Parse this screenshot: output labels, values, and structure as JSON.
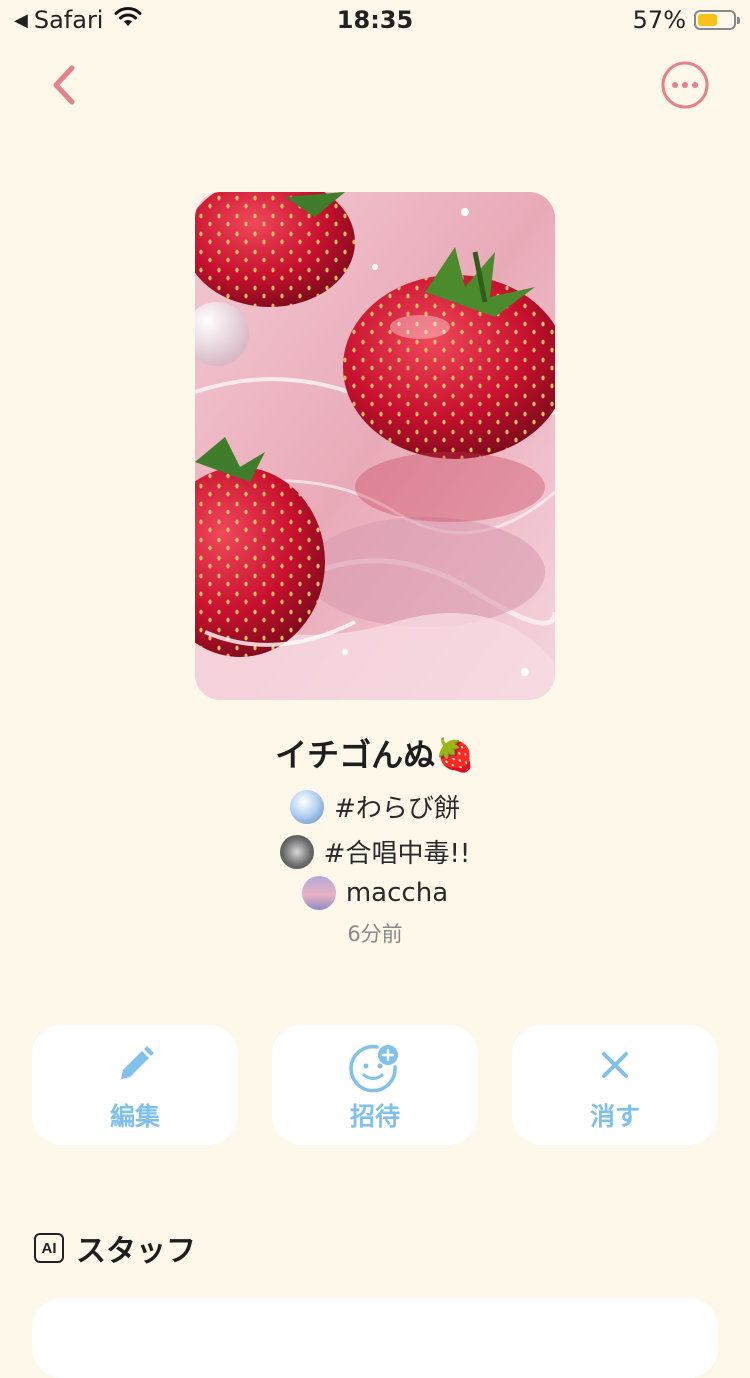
{
  "status_bar": {
    "back_app": "Safari",
    "time": "18:35",
    "battery_percent": "57%",
    "battery_level": 0.57,
    "wifi_icon": "wifi-icon"
  },
  "nav": {
    "back_icon": "chevron-left-icon",
    "more_icon": "more-horizontal-icon",
    "accent_color": "#e8808a"
  },
  "playlist": {
    "cover_image": "strawberry-cover-image",
    "title": "イチゴんぬ🍓",
    "tags": [
      {
        "label": "#わらび餅",
        "avatar": "tag-avatar-warabimochi"
      },
      {
        "label": "#合唱中毒!!",
        "avatar": "tag-avatar-gassho"
      }
    ],
    "owner": {
      "name": "maccha",
      "avatar": "owner-avatar"
    },
    "time_ago": "6分前"
  },
  "actions": [
    {
      "label": "編集",
      "icon": "pencil-icon"
    },
    {
      "label": "招待",
      "icon": "invite-face-icon"
    },
    {
      "label": "消す",
      "icon": "close-icon"
    }
  ],
  "action_color": "#7fc1ec",
  "staff": {
    "badge": "AI",
    "title": "スタッフ"
  }
}
